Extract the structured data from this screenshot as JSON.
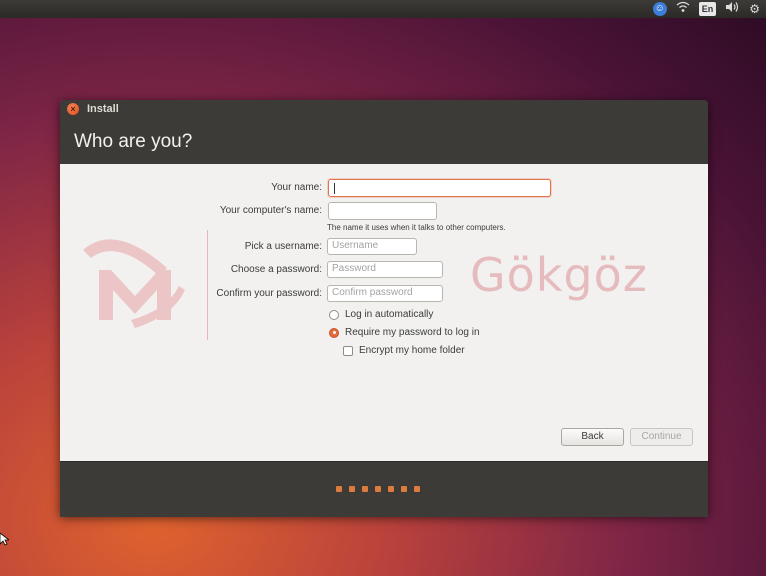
{
  "panel": {
    "keyboard_layout": "En",
    "icons": [
      "accessibility-icon",
      "wifi-icon",
      "keyboard-layout-indicator",
      "volume-icon",
      "settings-gear-icon"
    ]
  },
  "window": {
    "title": "Install",
    "page_title": "Who are you?"
  },
  "form": {
    "your_name_label": "Your name:",
    "your_name_value": "",
    "computer_name_label": "Your computer's name:",
    "computer_name_value": "",
    "computer_name_hint": "The name it uses when it talks to other computers.",
    "username_label": "Pick a username:",
    "username_placeholder": "Username",
    "password_label": "Choose a password:",
    "password_placeholder": "Password",
    "confirm_label": "Confirm your password:",
    "confirm_placeholder": "Confirm password",
    "login_auto_label": "Log in automatically",
    "require_password_label": "Require my password to log in",
    "encrypt_home_label": "Encrypt my home folder",
    "selected_login_option": "require_password",
    "encrypt_home_checked": false
  },
  "buttons": {
    "back": "Back",
    "continue": "Continue"
  },
  "watermark": {
    "text": "Gökgöz"
  },
  "progress": {
    "steps_total": 7
  },
  "colors": {
    "accent": "#dd4814",
    "dot": "#dd7a3e",
    "window_chrome": "#3c3b37"
  }
}
